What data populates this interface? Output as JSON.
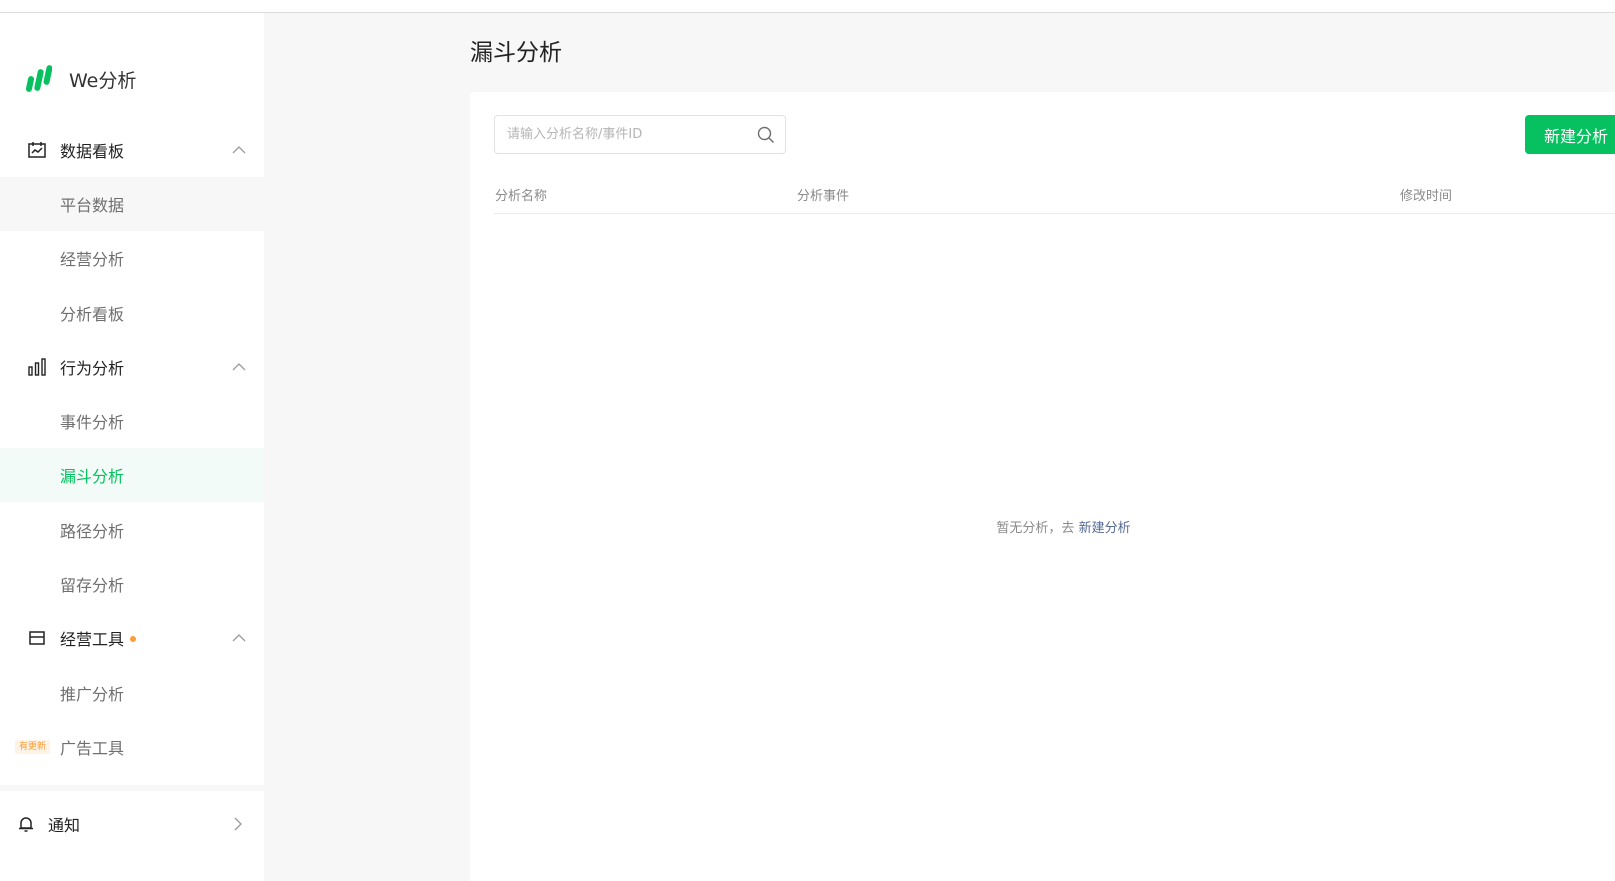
{
  "brand": {
    "name": "We分析",
    "accent": "#07c160"
  },
  "nav": {
    "groups": [
      {
        "label": "数据看板",
        "icon": "dashboard-icon",
        "items": [
          "平台数据",
          "经营分析",
          "分析看板"
        ]
      },
      {
        "label": "行为分析",
        "icon": "bar-chart-icon",
        "items": [
          "事件分析",
          "漏斗分析",
          "路径分析",
          "留存分析"
        ]
      },
      {
        "label": "经营工具",
        "icon": "store-icon",
        "items": [
          "推广分析",
          "广告工具"
        ]
      }
    ],
    "active_item": "漏斗分析",
    "ad_tool_badge": "有更新",
    "notify_label": "通知"
  },
  "page": {
    "title": "漏斗分析",
    "search_placeholder": "请输入分析名称/事件ID",
    "new_button_label": "新建分析",
    "columns": [
      "分析名称",
      "分析事件",
      "修改时间"
    ],
    "empty_text": "暂无分析，去",
    "empty_link": "新建分析"
  },
  "colors": {
    "primary": "#07c160",
    "badge": "#fa9d3b",
    "link": "#576b95"
  }
}
